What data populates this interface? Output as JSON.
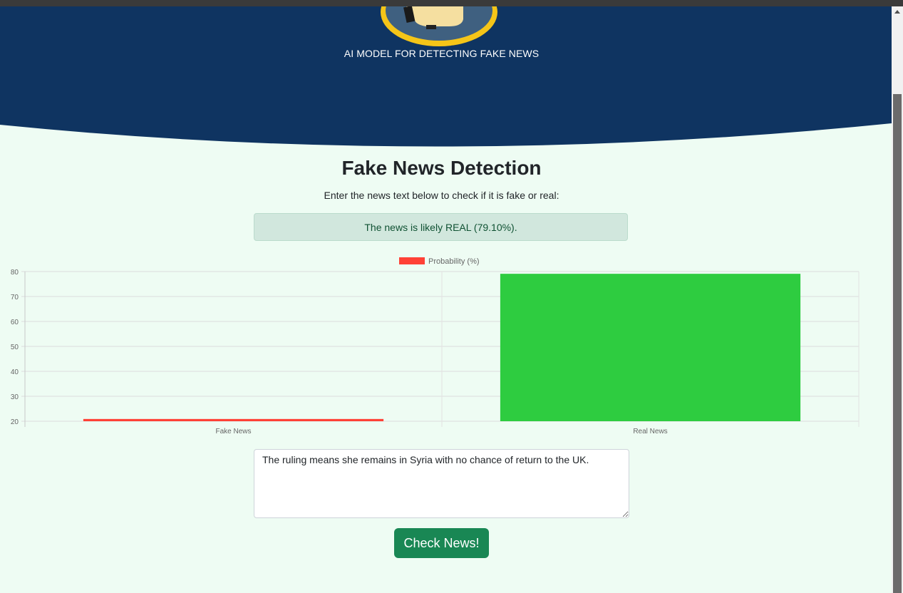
{
  "header": {
    "subtitle": "AI MODEL FOR DETECTING FAKE NEWS",
    "background_color": "#0f3461",
    "logo_border_color": "#f5c518"
  },
  "main": {
    "title": "Fake News Detection",
    "instruction": "Enter the news text below to check if it is fake or real:",
    "result_message": "The news is likely REAL (79.10%)."
  },
  "chart_data": {
    "type": "bar",
    "categories": [
      "Fake News",
      "Real News"
    ],
    "series": [
      {
        "name": "Probability (%)",
        "values": [
          20.9,
          79.1
        ],
        "colors": [
          "#ff4136",
          "#2ecc40"
        ]
      }
    ],
    "ylim": [
      20,
      80
    ],
    "yticks": [
      20,
      30,
      40,
      50,
      60,
      70,
      80
    ],
    "grid": true,
    "legend_position": "top"
  },
  "form": {
    "news_text": "The ruling means she remains in Syria with no chance of return to the UK.",
    "submit_label": "Check News!"
  },
  "colors": {
    "page_background": "#eefcf3",
    "success_button": "#198754",
    "alert_background": "#d1e7dd",
    "alert_text": "#0f5132"
  }
}
